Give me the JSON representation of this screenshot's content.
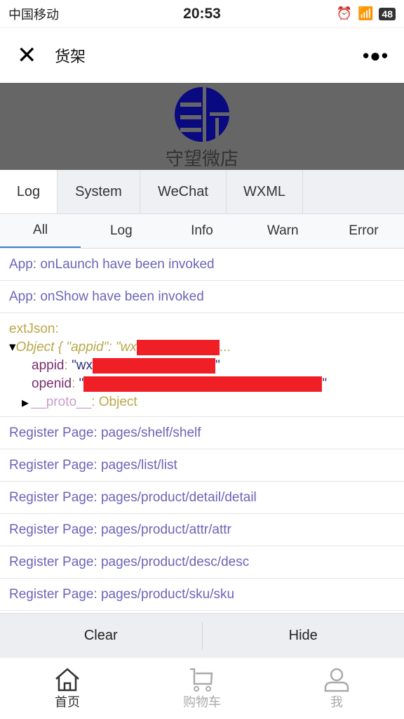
{
  "status": {
    "carrier": "中国移动",
    "time": "20:53",
    "battery": "48"
  },
  "nav": {
    "title": "货架",
    "close_icon": "close-icon",
    "more_icon": "more-icon"
  },
  "banner": {
    "shop_name": "守望微店",
    "logo_color": "#0a0a80"
  },
  "tabs": [
    {
      "label": "Log"
    },
    {
      "label": "System"
    },
    {
      "label": "WeChat"
    },
    {
      "label": "WXML"
    }
  ],
  "subtabs": [
    {
      "label": "All"
    },
    {
      "label": "Log"
    },
    {
      "label": "Info"
    },
    {
      "label": "Warn"
    },
    {
      "label": "Error"
    }
  ],
  "logs_top": [
    "App: onLaunch have been invoked",
    "App: onShow have been invoked"
  ],
  "ext": {
    "label": "extJson:",
    "summary": "Object { \"appid\": \"wx",
    "ellipsis": "...",
    "appid_key": "appid",
    "appid_prefix": "\"wx",
    "openid_key": "openid",
    "quote": "\"",
    "proto_key": "__proto__",
    "proto_val": "Object"
  },
  "logs_bottom": [
    "Register Page: pages/shelf/shelf",
    "Register Page: pages/list/list",
    "Register Page: pages/product/detail/detail",
    "Register Page: pages/product/attr/attr",
    "Register Page: pages/product/desc/desc",
    "Register Page: pages/product/sku/sku"
  ],
  "buttons": {
    "clear": "Clear",
    "hide": "Hide"
  },
  "tabbar": [
    {
      "label": "首页",
      "icon": "home-icon"
    },
    {
      "label": "购物车",
      "icon": "cart-icon"
    },
    {
      "label": "我",
      "icon": "user-icon"
    }
  ],
  "colors": {
    "accent": "#3b7fd6",
    "log_text": "#6d64b8",
    "redaction": "#f01e25"
  }
}
